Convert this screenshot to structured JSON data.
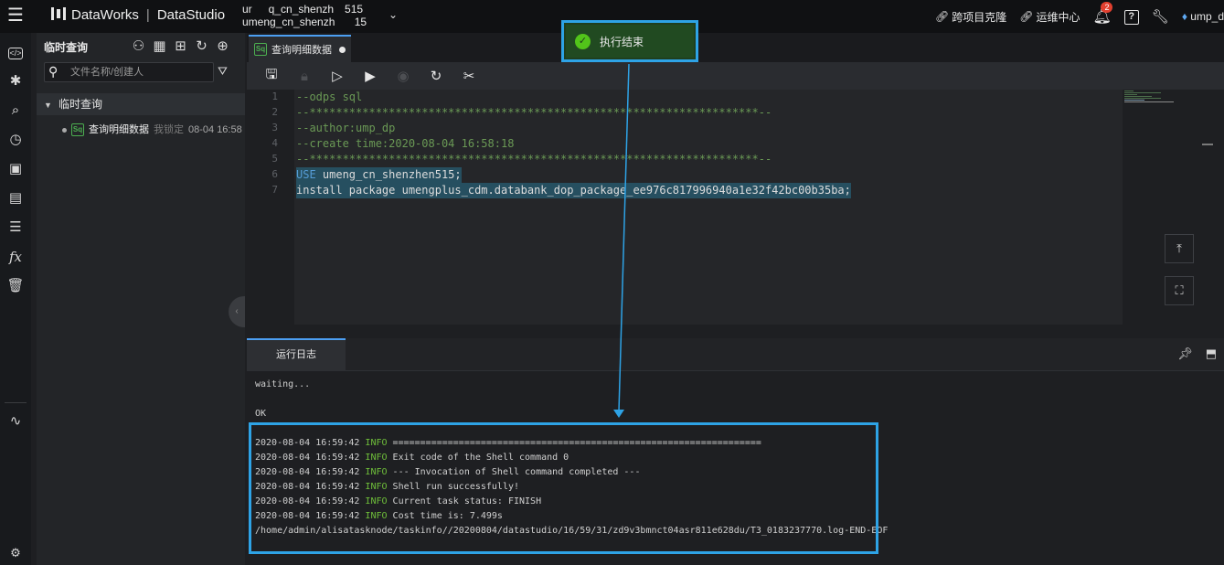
{
  "topbar": {
    "brand": "DataWorks",
    "product": "DataStudio",
    "workspace_line1": "ur  q_cn_shenzh 515",
    "workspace_line2": "umeng_cn_shenzh   15",
    "cross_project": "跨项目克隆",
    "ops_center": "运维中心",
    "notification_count": "2",
    "user": "ump_d"
  },
  "leftnav": {
    "items": [
      "code-icon",
      "puzzle-icon",
      "search-icon",
      "clock-icon",
      "briefcase-icon",
      "table-icon",
      "list-icon",
      "function-icon",
      "trash-icon",
      "pulse-icon",
      "settings-icon"
    ]
  },
  "sidebar": {
    "title": "临时查询",
    "search_placeholder": "文件名称/创建人",
    "root_label": "临时查询",
    "file": {
      "type_badge": "Sq",
      "name": "查询明细数据",
      "lock": "我锁定",
      "time": "08-04 16:58"
    }
  },
  "tab": {
    "badge": "Sq",
    "label": "查询明细数据"
  },
  "editor": {
    "line_numbers": [
      "1",
      "2",
      "3",
      "4",
      "5",
      "6",
      "7"
    ],
    "lines": [
      "--odps sql",
      "--********************************************************************--",
      "--author:ump_dp",
      "--create time:2020-08-04 16:58:18",
      "--********************************************************************--",
      "USE umeng_cn_shenzhen515;",
      "install package umengplus_cdm.databank_dop_package_ee976c817996940a1e32f42bc00b35ba;"
    ],
    "use_keyword": "USE",
    "use_rest": " umeng_cn_shenzhen515;"
  },
  "toast": {
    "text": "执行结束"
  },
  "log": {
    "tab_label": "运行日志",
    "waiting": "waiting...",
    "ok": "OK",
    "entries": [
      {
        "time": "2020-08-04 16:59:42",
        "level": "INFO",
        "msg": "==================================================================="
      },
      {
        "time": "2020-08-04 16:59:42",
        "level": "INFO",
        "msg": "Exit code of the Shell command 0"
      },
      {
        "time": "2020-08-04 16:59:42",
        "level": "INFO",
        "msg": "--- Invocation of Shell command completed ---"
      },
      {
        "time": "2020-08-04 16:59:42",
        "level": "INFO",
        "msg": "Shell run successfully!"
      },
      {
        "time": "2020-08-04 16:59:42",
        "level": "INFO",
        "msg": "Current task status: FINISH"
      },
      {
        "time": "2020-08-04 16:59:42",
        "level": "INFO",
        "msg": "Cost time is: 7.499s"
      }
    ],
    "path": "/home/admin/alisatasknode/taskinfo//20200804/datastudio/16/59/31/zd9v3bmnct04asr811e628du/T3_0183237770.log-END-EOF"
  },
  "colors": {
    "highlight": "#2ea3e6",
    "success": "#52c41a",
    "info": "#6fbf3a",
    "comment": "#6a9955",
    "keyword": "#569cd6"
  }
}
